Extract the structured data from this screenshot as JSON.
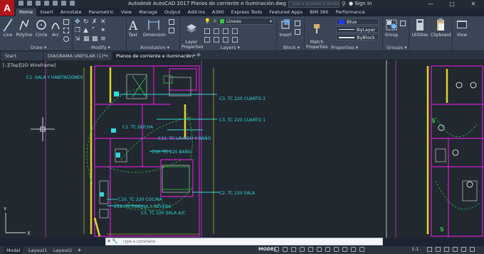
{
  "app": {
    "logo_letter": "A",
    "title": "Autodesk AutoCAD 2017   Planos de corriente e iluminación.dwg",
    "search_placeholder": "Type a keyword or phrase",
    "signin": "Sign In",
    "window_controls": [
      "—",
      "□",
      "✕"
    ]
  },
  "ribbon": {
    "tabs": [
      "Home",
      "Insert",
      "Annotate",
      "Parametric",
      "View",
      "Manage",
      "Output",
      "Add-ins",
      "A360",
      "Express Tools",
      "Featured Apps",
      "BIM 360",
      "Performance"
    ],
    "active_tab": "Home",
    "draw": {
      "line": "Line",
      "polyline": "Polyline",
      "circle": "Circle",
      "arc": "Arc",
      "panel": "Draw ▾"
    },
    "modify": {
      "panel": "Modify ▾"
    },
    "annotation": {
      "text": "Text",
      "dimension": "Dimension",
      "panel": "Annotation ▾"
    },
    "layers": {
      "layer_properties": "Layer\nProperties",
      "current_layer": "Lineas",
      "panel": "Layers ▾"
    },
    "block": {
      "insert": "Insert",
      "panel": "Block ▾"
    },
    "properties": {
      "match": "Match\nProperties",
      "color": "Blue",
      "linetype": "ByLayer",
      "lineweight": "ByBlock",
      "panel": "Properties ▾"
    },
    "groups": {
      "group": "Group",
      "panel": "Groups ▾"
    },
    "utilities": "Utilities",
    "clipboard": "Clipboard",
    "view": "View"
  },
  "file_tabs": [
    {
      "label": "Start",
      "active": false
    },
    {
      "label": "DIAGRAMA UNIFILAR (1)*",
      "active": false
    },
    {
      "label": "Planos de corriente e iluminación*",
      "active": true
    }
  ],
  "viewport": {
    "label": "[–][Top][2D Wireframe]"
  },
  "drawing_labels": [
    "C1. SALA Y HABITACIONES",
    "C3. TC 220 CUARTO 2",
    "C3. TC 220 CUARTO 1",
    "C1. TC DUCHA",
    "C11. TC LAVADO Y BAÑO",
    "C10. TC 220 BAÑO",
    "C2. TC 220 SALA",
    "C10. TC 220 COCINA",
    "C11. TC COCINA Y NEVERA",
    "C5. TC 220 SALA A/C"
  ],
  "ucs": {
    "x": "X",
    "y": "Y"
  },
  "command": {
    "placeholder": "Type a command"
  },
  "status": {
    "layout_tabs": [
      "Model",
      "Layout1",
      "Layout2"
    ],
    "mode": "MODEL",
    "scale": "1:1"
  },
  "colors": {
    "canvas": "#212830",
    "walls": "#d21fd2",
    "circuits": "#31d9d9",
    "yellow": "#e6d22c",
    "green": "#32c83c",
    "accent_red": "#b3131b"
  }
}
